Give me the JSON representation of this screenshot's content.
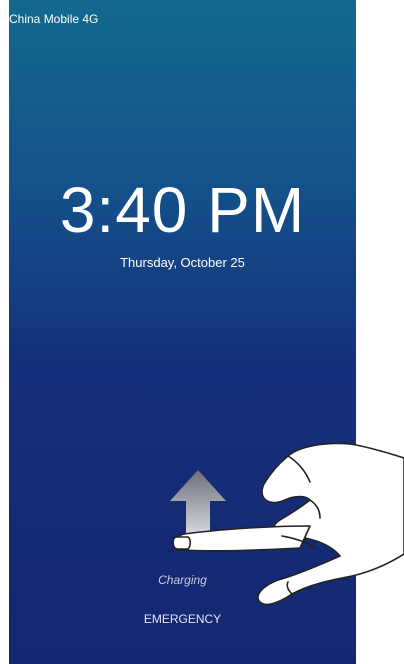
{
  "status_bar": {
    "carrier": "China Mobile 4G"
  },
  "lock_screen": {
    "time": "3:40 PM",
    "date": "Thursday, October 25",
    "charging_status": "Charging",
    "emergency_label": "EMERGENCY"
  },
  "gesture_hint": {
    "direction": "up",
    "arrow_icon": "swipe-up-arrow-icon",
    "hand_icon": "pointing-hand-icon"
  },
  "colors": {
    "gradient_top": "#14698d",
    "gradient_bottom": "#152671",
    "text": "#ffffff"
  }
}
